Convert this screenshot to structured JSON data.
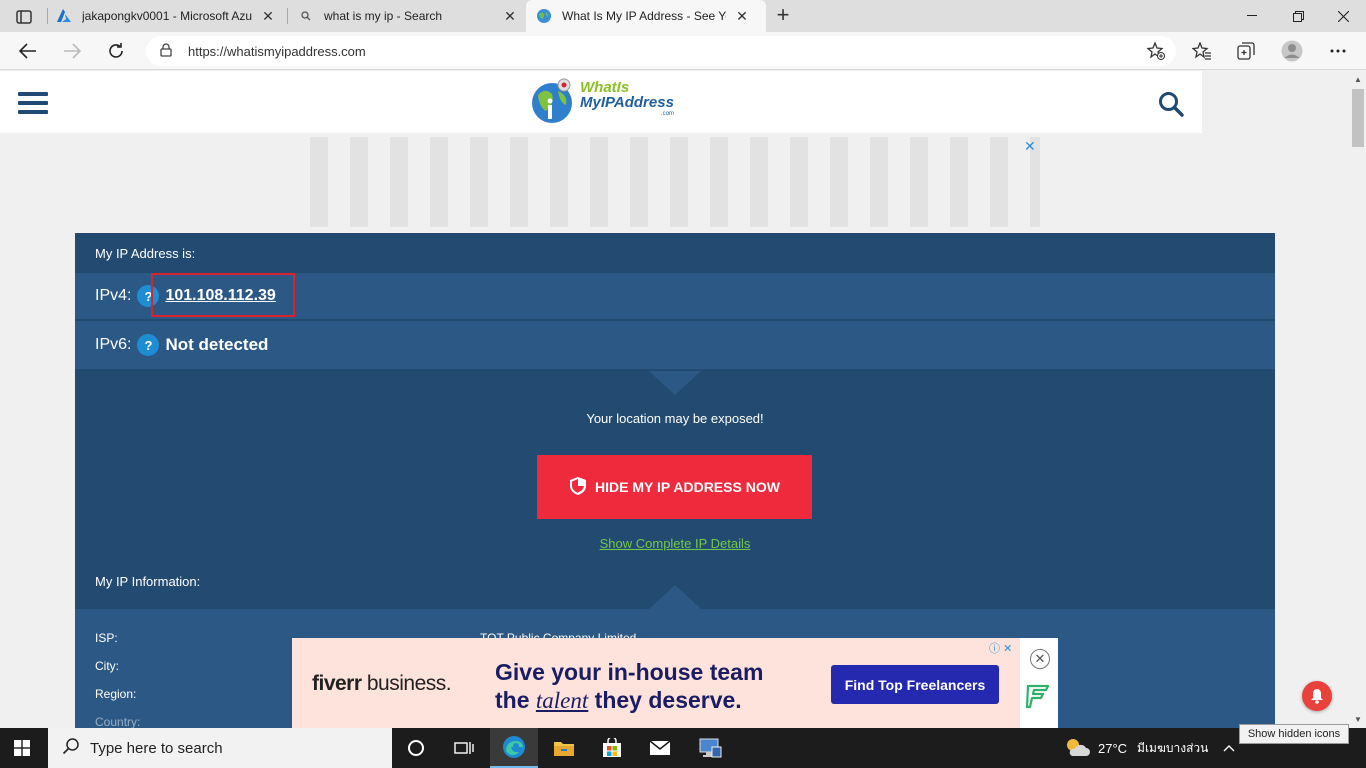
{
  "browser": {
    "tabs": [
      {
        "title": "jakapongkv0001 - Microsoft Azu",
        "icon": "azure-icon"
      },
      {
        "title": "what is my ip - Search",
        "icon": "search-icon"
      },
      {
        "title": "What Is My IP Address - See You",
        "icon": "globe-icon",
        "active": true
      }
    ],
    "url": "https://whatismyipaddress.com"
  },
  "site": {
    "logo": {
      "line1": "WhatIs",
      "line2": "MyIPAddress",
      "line3": ".com"
    },
    "ad_close": "✕",
    "panel": {
      "title": "My IP Address is:",
      "ipv4_label": "IPv4:",
      "ipv4_value": "101.108.112.39",
      "ipv6_label": "IPv6:",
      "ipv6_value": "Not detected",
      "help_mark": "?",
      "exposed_text": "Your location may be exposed!",
      "hide_button": "HIDE MY IP ADDRESS NOW",
      "details_link": "Show Complete IP Details",
      "info_title": "My IP Information:",
      "info_rows": [
        {
          "label": "ISP:",
          "value": "TOT Public Company Limited"
        },
        {
          "label": "City:",
          "value": ""
        },
        {
          "label": "Region:",
          "value": ""
        },
        {
          "label": "Country:",
          "value": ""
        }
      ]
    },
    "bottom_ad": {
      "brand_bold": "fiverr",
      "brand_rest": " business.",
      "headline_1": "Give your in-house team",
      "headline_2a": "the ",
      "headline_2b": "talent",
      "headline_2c": " they deserve.",
      "cta": "Find Top Freelancers",
      "close": "✕"
    }
  },
  "taskbar": {
    "search_placeholder": "Type here to search",
    "weather": "27°C",
    "weather_desc": "มีเมฆบางส่วน",
    "tooltip": "Show hidden icons"
  },
  "colors": {
    "panel_dark": "#234b72",
    "panel_light": "#2c5885",
    "hide_button": "#ef2a3c",
    "link_green": "#72c84a",
    "highlight_red": "#d9232d"
  }
}
